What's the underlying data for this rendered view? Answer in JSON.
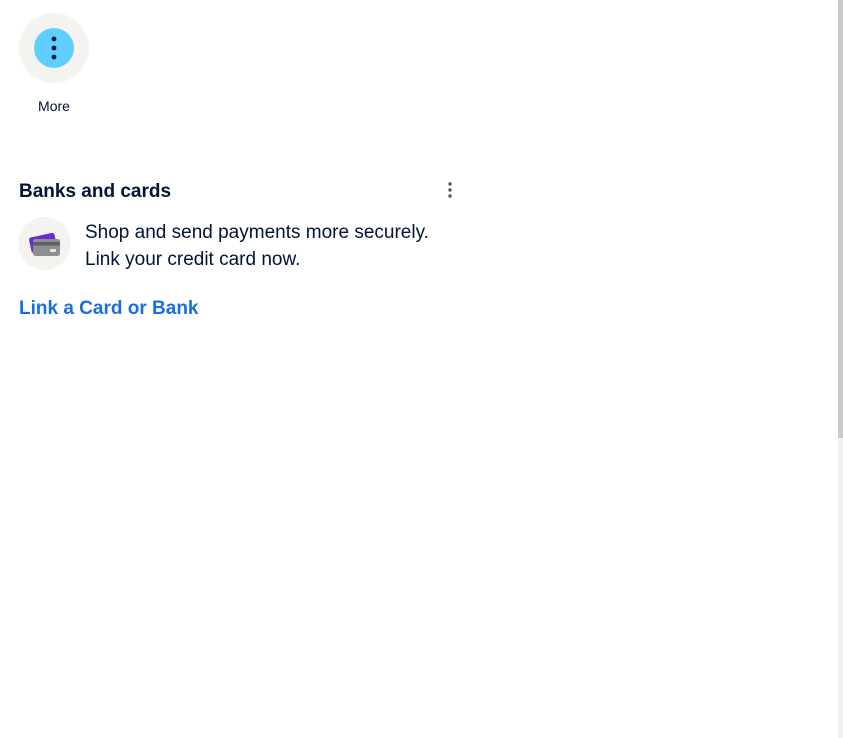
{
  "quick_actions": {
    "more": {
      "label": "More",
      "icon": "vertical-dots-icon"
    }
  },
  "banks_and_cards": {
    "title": "Banks and cards",
    "options_icon": "vertical-dots-icon",
    "promo": {
      "icon": "credit-card-icon",
      "line1": "Shop and send payments more securely.",
      "line2": "Link your credit card now."
    },
    "link_label": "Link a Card or Bank"
  },
  "colors": {
    "text": "#001435",
    "link": "#1a6fdc",
    "more_accent": "#60cdff",
    "tile_bg": "#f5f3ef"
  }
}
